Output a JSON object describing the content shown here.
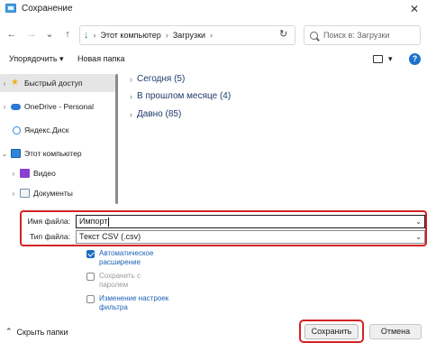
{
  "window": {
    "title": "Сохранение",
    "close_glyph": "✕"
  },
  "nav": {
    "back": "←",
    "forward": "→",
    "dropdown": "⌄",
    "up": "↑"
  },
  "address": {
    "crumbs": [
      "Этот компьютер",
      "Загрузки"
    ],
    "separator": "›",
    "refresh": "↻"
  },
  "search": {
    "placeholder": "Поиск в: Загрузки"
  },
  "toolbar": {
    "organize": "Упорядочить ▾",
    "new_folder": "Новая папка",
    "view_dropdown": "▾",
    "help": "?"
  },
  "sidebar": {
    "items": [
      {
        "label": "Быстрый доступ",
        "icon": "star-icon",
        "expander": "›"
      },
      {
        "label": "OneDrive - Personal",
        "icon": "cloud-icon",
        "expander": "›"
      },
      {
        "label": "Яндекс.Диск",
        "icon": "disk-icon",
        "expander": ""
      },
      {
        "label": "Этот компьютер",
        "icon": "computer-icon",
        "expander": "⌄"
      },
      {
        "label": "Видео",
        "icon": "video-icon",
        "expander": "›"
      },
      {
        "label": "Документы",
        "icon": "documents-icon",
        "expander": "›"
      }
    ]
  },
  "groups": [
    {
      "label": "Сегодня (5)"
    },
    {
      "label": "В прошлом месяце (4)"
    },
    {
      "label": "Давно (85)"
    }
  ],
  "form": {
    "filename_label": "Имя файла:",
    "filename_value": "Импорт",
    "filetype_label": "Тип файла:",
    "filetype_value": "Текст CSV (.csv)",
    "dropdown_glyph": "⌄"
  },
  "options": [
    {
      "lines": [
        "Автоматическое",
        "расширение"
      ],
      "checked": true,
      "enabled": true
    },
    {
      "lines": [
        "Сохранить с",
        "паролем"
      ],
      "checked": false,
      "enabled": false
    },
    {
      "lines": [
        "Изменение настроек",
        "фильтра"
      ],
      "checked": false,
      "enabled": true
    }
  ],
  "bottom": {
    "hide_folders": "Скрыть папки",
    "hide_glyph": "⌃",
    "save": "Сохранить",
    "cancel": "Отмена"
  },
  "colors": {
    "highlight": "#d42222",
    "link": "#1b63b6",
    "accent": "#1b6ec2"
  }
}
